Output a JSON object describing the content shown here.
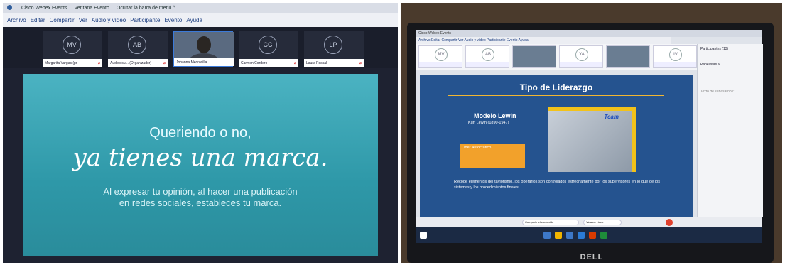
{
  "left": {
    "window_title": "Cisco Webex Events",
    "tabs": [
      "Ventana Evento",
      "Ocultar la barra de menú ^"
    ],
    "menu": [
      "Archivo",
      "Editar",
      "Compartir",
      "Ver",
      "Audio y vídeo",
      "Participante",
      "Evento",
      "Ayuda"
    ],
    "participants": [
      {
        "initials": "MV",
        "name": "Margarita Vargas (pr",
        "video": false
      },
      {
        "initials": "AB",
        "name": "Audiovisu... (Organizador)",
        "video": false
      },
      {
        "initials": "",
        "name": "Johanna Medrosilla",
        "video": true
      },
      {
        "initials": "CC",
        "name": "Carmen Cordero",
        "video": false
      },
      {
        "initials": "LP",
        "name": "Laura Pascal",
        "video": false
      }
    ],
    "slide": {
      "line1": "Queriendo o no,",
      "line2": "ya tienes una marca.",
      "line3": "Al expresar tu opinión, al hacer una publicación",
      "line4": "en redes sociales, estableces tu marca."
    }
  },
  "right": {
    "window_title": "Cisco Webex Events",
    "menu": "Archivo  Editar  Compartir  Ver  Audio y vídeo  Participante  Evento  Ayuda",
    "participants": [
      {
        "initials": "MV",
        "video": false
      },
      {
        "initials": "AB",
        "video": false
      },
      {
        "initials": "",
        "video": true
      },
      {
        "initials": "YA",
        "video": false
      },
      {
        "initials": "",
        "video": true
      },
      {
        "initials": "IV",
        "video": false
      }
    ],
    "slide": {
      "title": "Tipo de Liderazgo",
      "model": "Modelo Lewin",
      "author": "Kurt Lewin (1890-1947)",
      "box_text": "Líder Autocrático",
      "photo_caption": "Team",
      "paragraph": "Recoge elementos del taylorismo, los operarios son controlados estrechamente por los supervisores en lo que de los sistemas y los procedimientos finales."
    },
    "sidebar": {
      "participants": "Participantes (13)",
      "panelists": "Panelistas 6",
      "chat_placeholder": "Texto de subasarnos:"
    },
    "bottom_bar": [
      "Compartir el contenido",
      "Vida en vídeo"
    ],
    "brand": "DELL"
  }
}
